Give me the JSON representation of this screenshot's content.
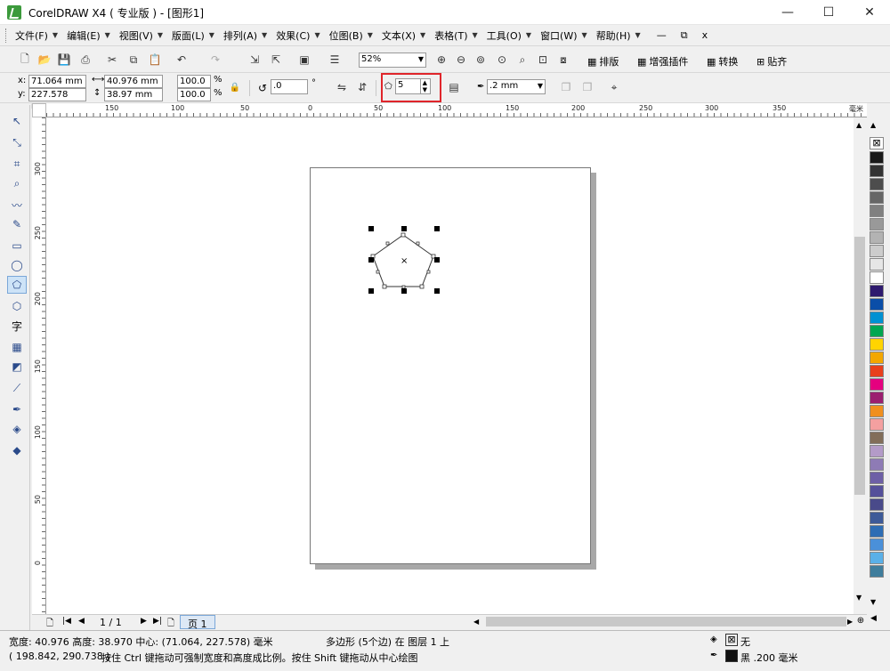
{
  "window": {
    "title": "CorelDRAW X4 ( 专业版 ) - [图形1]",
    "min_glyph": "—",
    "max_glyph": "☐",
    "close_glyph": "✕"
  },
  "menu": {
    "items": [
      "文件(F)",
      "编辑(E)",
      "视图(V)",
      "版面(L)",
      "排列(A)",
      "效果(C)",
      "位图(B)",
      "文本(X)",
      "表格(T)",
      "工具(O)",
      "窗口(W)",
      "帮助(H)"
    ],
    "mdi_min": "—",
    "mdi_restore": "⧉",
    "mdi_close": "x"
  },
  "standard_toolbar": {
    "zoom": "52%",
    "btn_layout": "排版",
    "btn_plugin": "增强插件",
    "btn_convert": "转换",
    "btn_snap": "贴齐"
  },
  "property_bar": {
    "x_label": "x:",
    "y_label": "y:",
    "x": "71.064 mm",
    "y": "227.578 mm",
    "width": "40.976 mm",
    "height": "38.97 mm",
    "scale_x": "100.0",
    "scale_y": "100.0",
    "pct": "%",
    "rotation": ".0",
    "degree": "°",
    "sides": "5",
    "outline_width": ".2 mm"
  },
  "rulers": {
    "unit": "毫米",
    "h_labels": [
      "150",
      "100",
      "50",
      "0",
      "50",
      "100",
      "150",
      "200",
      "250",
      "300",
      "350"
    ],
    "v_labels": [
      "300",
      "250",
      "200",
      "150",
      "100",
      "50",
      "0"
    ]
  },
  "page_nav": {
    "counter": "1 / 1",
    "tab": "页 1"
  },
  "status": {
    "line1_left": "宽度: 40.976  高度: 38.970  中心: (71.064, 227.578)  毫米",
    "line1_mid": "多边形 (5个边) 在 图层 1 上",
    "line2_left": "( 198.842, 290.738 )",
    "line2_hint": "按住 Ctrl 键拖动可强制宽度和高度成比例。按住 Shift 键拖动从中心绘图",
    "fill_label": "无",
    "outline_label": "黑  .200 毫米"
  },
  "palette_colors": [
    "#1a1a1a",
    "#333333",
    "#4d4d4d",
    "#666666",
    "#808080",
    "#999999",
    "#b3b3b3",
    "#cccccc",
    "#e6e6e6",
    "#ffffff",
    "#2e1a6e",
    "#0a4ea8",
    "#0091d2",
    "#00a651",
    "#ffd400",
    "#f3a700",
    "#e8401c",
    "#e5007f",
    "#9b1e6f",
    "#f08f1e",
    "#f4a0a0",
    "#826e5a",
    "#b39bc8",
    "#8e7bb5",
    "#6d5fa6",
    "#55509a",
    "#494a8a",
    "#3d5a98",
    "#2e6db4",
    "#4a90d9",
    "#5ab0e8",
    "#3f7d9c"
  ],
  "accent": "#e0252b"
}
